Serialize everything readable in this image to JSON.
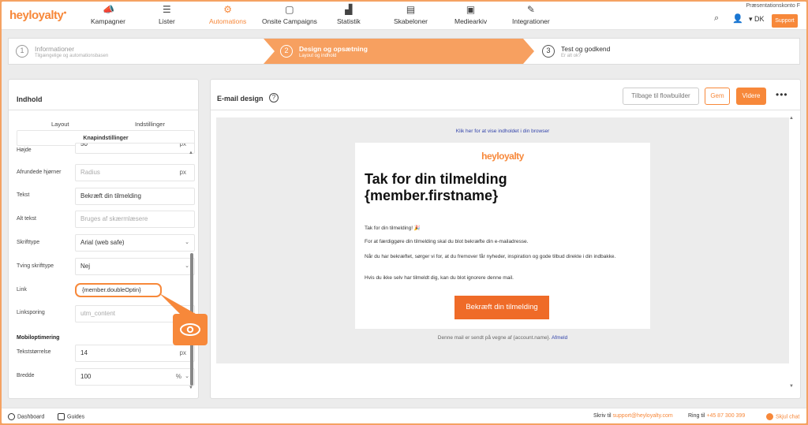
{
  "brand": {
    "logo": "heyloyalty",
    "accent": "#f7883a"
  },
  "nav": {
    "items": [
      {
        "label": "Kampagner",
        "icon": "megaphone-icon"
      },
      {
        "label": "Lister",
        "icon": "list-icon"
      },
      {
        "label": "Automations",
        "icon": "automation-icon",
        "active": true
      },
      {
        "label": "Onsite Campaigns",
        "icon": "onsite-icon"
      },
      {
        "label": "Statistik",
        "icon": "chart-icon"
      },
      {
        "label": "Skabeloner",
        "icon": "template-icon"
      },
      {
        "label": "Mediearkiv",
        "icon": "image-icon"
      },
      {
        "label": "Integrationer",
        "icon": "plug-icon"
      }
    ],
    "account": "Præsentationskonto F",
    "language": "DK",
    "support": "Support"
  },
  "stepper": {
    "steps": [
      {
        "num": "1",
        "title": "Informationer",
        "sub": "Tilgængelige og automationsbasen"
      },
      {
        "num": "2",
        "title": "Design og opsætning",
        "sub": "Layout og indhold"
      },
      {
        "num": "3",
        "title": "Test og godkend",
        "sub": "Er alt ok?"
      }
    ]
  },
  "left": {
    "title": "Indhold",
    "tabs": [
      "Layout",
      "Indstillinger"
    ],
    "subtab": "Knapindstillinger",
    "rows": [
      {
        "label": "Højde",
        "value": "50",
        "suffix": "px",
        "placeholder": false
      },
      {
        "label": "Afrundede hjørner",
        "value": "Radius",
        "suffix": "px",
        "placeholder": true
      },
      {
        "label": "Tekst",
        "value": "Bekræft din tilmelding",
        "placeholder": false
      },
      {
        "label": "Alt tekst",
        "value": "Bruges af skærmlæsere",
        "placeholder": true
      },
      {
        "label": "Skrifttype",
        "value": "Arial (web safe)",
        "dropdown": true
      },
      {
        "label": "Tving skrifttype",
        "value": "Nej",
        "dropdown": true
      },
      {
        "label": "Link",
        "value": "{member.doubleOptin}",
        "highlight": true
      },
      {
        "label": "Linksporing",
        "value": "utm_content",
        "placeholder": true
      }
    ],
    "mobile_section": "Mobiloptimering",
    "mobile_rows": [
      {
        "label": "Tekststørrelse",
        "value": "14",
        "suffix": "px"
      },
      {
        "label": "Bredde",
        "value": "100",
        "suffix": "%"
      }
    ]
  },
  "right": {
    "title": "E-mail design",
    "buttons": {
      "back": "Tilbage til flowbuilder",
      "save": "Gem",
      "next": "Videre"
    },
    "preview": {
      "browser_link": "Klik her for at vise indholdet i din browser",
      "logo": "heyloyalty",
      "heading_line1": "Tak for din tilmelding",
      "heading_line2": "{member.firstname}",
      "p1": "Tak for din tilmelding! 🎉",
      "p2": "For at færdiggøre din tilmelding skal du blot bekræfte din e-mailadresse.",
      "p3": "Når du har bekræftet, sørger vi for, at du fremover får nyheder, inspiration og gode tilbud direkte i din indbakke.",
      "p4": "Hvis du ikke selv har tilmeldt dig, kan du blot ignorere denne mail.",
      "cta": "Bekræft din tilmelding",
      "footer": "Denne mail er sendt på vegne af {account.name}.",
      "footer_link": "Afmeld"
    }
  },
  "bottom": {
    "dashboard": "Dashboard",
    "guides": "Guides",
    "write_to": "Skriv til",
    "email": "support@heyloyalty.com",
    "call": "Ring til",
    "phone": "+45 87 300 399",
    "hide_chat": "Skjul chat"
  }
}
